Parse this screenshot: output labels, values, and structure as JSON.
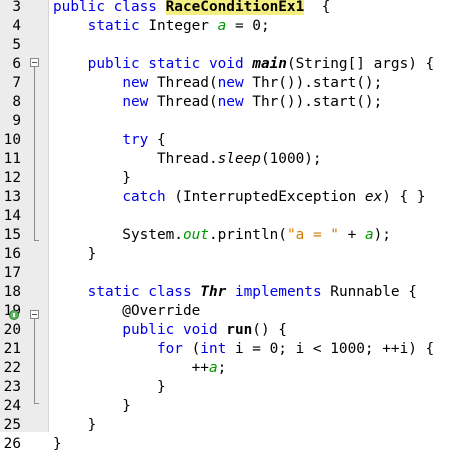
{
  "editor": {
    "lines": [
      {
        "n": "3",
        "parts": [
          [
            "kw",
            "public class "
          ],
          [
            "hl",
            "RaceConditionEx1"
          ],
          [
            "",
            "  {"
          ]
        ]
      },
      {
        "n": "4",
        "parts": [
          [
            "",
            "    "
          ],
          [
            "kw",
            "static "
          ],
          [
            "",
            "Integer "
          ],
          [
            "sfld",
            "a"
          ],
          [
            "",
            " = 0;"
          ]
        ]
      },
      {
        "n": "5",
        "parts": []
      },
      {
        "n": "6",
        "parts": [
          [
            "",
            "    "
          ],
          [
            "kw",
            "public static void "
          ],
          [
            "fn it",
            "main"
          ],
          [
            "",
            "(String[] args) {"
          ]
        ]
      },
      {
        "n": "7",
        "parts": [
          [
            "",
            "        "
          ],
          [
            "kw",
            "new "
          ],
          [
            "",
            "Thread("
          ],
          [
            "kw",
            "new "
          ],
          [
            "",
            "Thr()).start();"
          ]
        ]
      },
      {
        "n": "8",
        "parts": [
          [
            "",
            "        "
          ],
          [
            "kw",
            "new "
          ],
          [
            "",
            "Thread("
          ],
          [
            "kw",
            "new "
          ],
          [
            "",
            "Thr()).start();"
          ]
        ]
      },
      {
        "n": "9",
        "parts": []
      },
      {
        "n": "10",
        "parts": [
          [
            "",
            "        "
          ],
          [
            "kw",
            "try "
          ],
          [
            "",
            "{"
          ]
        ]
      },
      {
        "n": "11",
        "parts": [
          [
            "",
            "            Thread."
          ],
          [
            "it",
            "sleep"
          ],
          [
            "",
            "(1000);"
          ]
        ]
      },
      {
        "n": "12",
        "parts": [
          [
            "",
            "        }"
          ]
        ]
      },
      {
        "n": "13",
        "parts": [
          [
            "",
            "        "
          ],
          [
            "kw",
            "catch "
          ],
          [
            "",
            "(InterruptedException "
          ],
          [
            "it",
            "ex"
          ],
          [
            "",
            ") { }"
          ]
        ]
      },
      {
        "n": "14",
        "parts": []
      },
      {
        "n": "15",
        "parts": [
          [
            "",
            "        System."
          ],
          [
            "sfld",
            "out"
          ],
          [
            "",
            ".println("
          ],
          [
            "str",
            "\"a = \""
          ],
          [
            "",
            " + "
          ],
          [
            "sfld",
            "a"
          ],
          [
            "",
            ");"
          ]
        ]
      },
      {
        "n": "16",
        "parts": [
          [
            "",
            "    }"
          ]
        ]
      },
      {
        "n": "17",
        "parts": []
      },
      {
        "n": "18",
        "parts": [
          [
            "",
            "    "
          ],
          [
            "kw",
            "static class "
          ],
          [
            "fn it",
            "Thr"
          ],
          [
            "",
            " "
          ],
          [
            "kw",
            "implements "
          ],
          [
            "",
            "Runnable {"
          ]
        ]
      },
      {
        "n": "19",
        "parts": [
          [
            "",
            "        @Override"
          ]
        ]
      },
      {
        "n": "20",
        "parts": [
          [
            "",
            "        "
          ],
          [
            "kw",
            "public void "
          ],
          [
            "fn",
            "run"
          ],
          [
            "",
            "() {"
          ]
        ]
      },
      {
        "n": "21",
        "parts": [
          [
            "",
            "            "
          ],
          [
            "kw",
            "for "
          ],
          [
            "",
            "("
          ],
          [
            "kw",
            "int "
          ],
          [
            "",
            "i = 0; i < 1000; ++i) {"
          ]
        ]
      },
      {
        "n": "22",
        "parts": [
          [
            "",
            "                ++"
          ],
          [
            "sfld",
            "a"
          ],
          [
            "",
            ";"
          ]
        ]
      },
      {
        "n": "23",
        "parts": [
          [
            "",
            "            }"
          ]
        ]
      },
      {
        "n": "24",
        "parts": [
          [
            "",
            "        }"
          ]
        ]
      },
      {
        "n": "25",
        "parts": [
          [
            "",
            "    }"
          ]
        ]
      },
      {
        "n": "26",
        "parts": [
          [
            "",
            "}"
          ]
        ]
      }
    ]
  },
  "colors": {
    "keyword": "#0000e6",
    "string": "#ce7b00",
    "field": "#009900",
    "highlight": "#f4ee82"
  }
}
